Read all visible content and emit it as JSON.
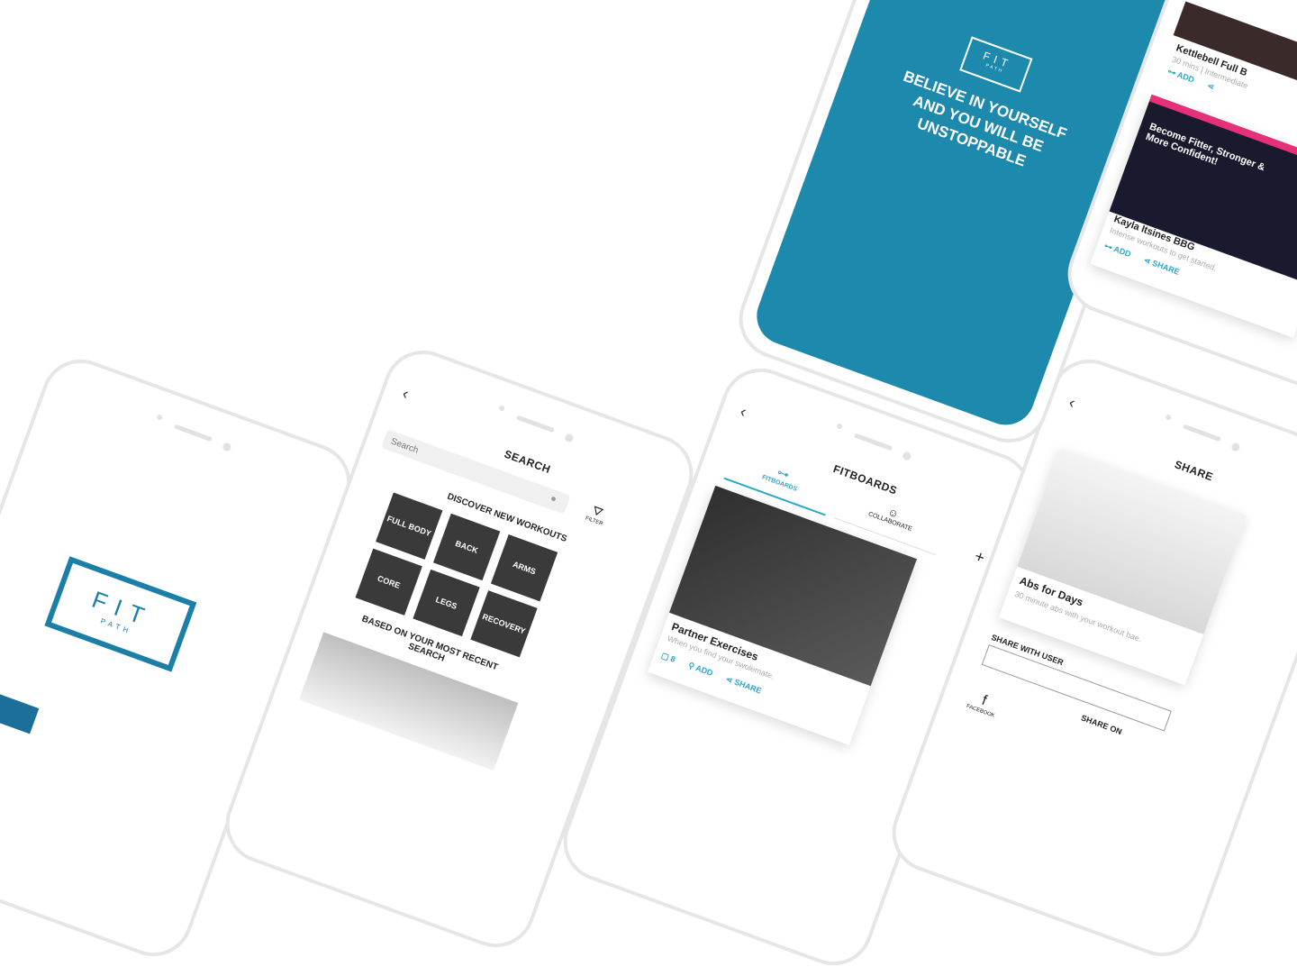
{
  "brand": {
    "logo_main": "FIT",
    "logo_sub": "PATH",
    "accent": "#29a8c9",
    "deep": "#1b6f9b"
  },
  "splash": {
    "quote": "BELIEVE IN YOURSELF AND YOU WILL BE UNSTOPPABLE"
  },
  "search": {
    "title": "SEARCH",
    "placeholder": "Search",
    "filter_label": "FILTER",
    "discover_heading": "DISCOVER NEW WORKOUTS",
    "categories": [
      "FULL BODY",
      "BACK",
      "ARMS",
      "CORE",
      "LEGS",
      "RECOVERY"
    ],
    "recent_heading": "BASED ON YOUR MOST RECENT SEARCH"
  },
  "fitboards": {
    "title": "FITBOARDS",
    "tab_fitboards": "FITBOARDS",
    "tab_collaborate": "COLLABORATE",
    "card_title": "Partner Exercises",
    "card_subtitle": "When you find your swolemate.",
    "count": "8",
    "add_label": "ADD",
    "share_label": "SHARE"
  },
  "share": {
    "title": "SHARE",
    "card_title": "Abs for Days",
    "card_subtitle": "30 minute abs with your workout bae.",
    "share_with_user": "SHARE WITH USER",
    "share_on": "SHARE ON",
    "facebook": "FACEBOOK"
  },
  "list": {
    "item1_title": "Kettlebell Full B",
    "item1_meta": "30 mins | Intermediate",
    "item2_title": "Kayla Itsines BBG",
    "item2_meta": "Intense workouts to get started.",
    "promo_headline": "Become Fitter, Stronger & More Confident!",
    "add_label": "ADD",
    "share_label": "SHARE"
  }
}
